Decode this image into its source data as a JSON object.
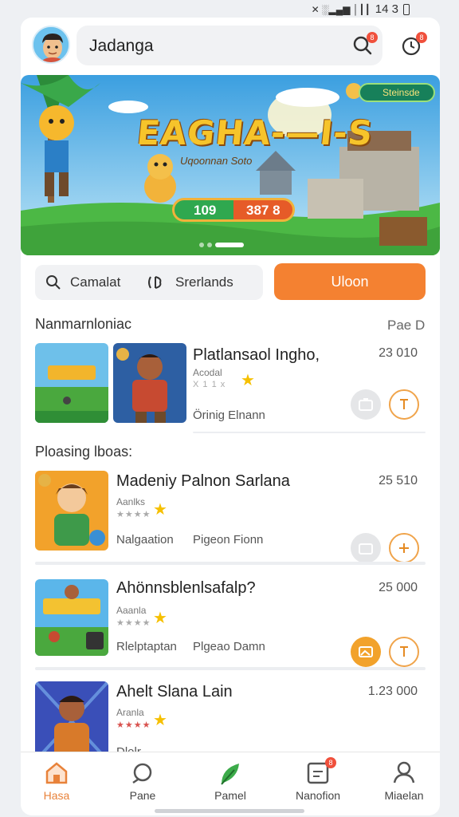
{
  "status_bar": {
    "indicators": "✕ ░▂▄▆ │┃┃",
    "battery": "14 3"
  },
  "header": {
    "search_value": "Jadanga",
    "notif_badge": "8",
    "clock_badge": "8"
  },
  "banner": {
    "title": "EAGHA-—I-S",
    "subtitle": "Uqoonnan Soto",
    "pill_label": "Steinsde",
    "progress_left": "109",
    "progress_right": "387 8"
  },
  "filters": {
    "chip1": "Camalat",
    "chip2": "Srerlands",
    "cta": "Uloon"
  },
  "sections": {
    "s1_title": "Nanmarnloniac",
    "s1_link": "Pae D",
    "s2_title": "Ploasing lboas:"
  },
  "items": [
    {
      "title": "Platlansaol Ingho,",
      "price": "23 010",
      "meta": "Acodal",
      "stars": "★★★★★",
      "rating_text": "X 1 1 x",
      "sub": "Örinig Elnann"
    },
    {
      "title": "Madeniy Palnon Sarlana",
      "price": "25 510",
      "meta": "Aanlks",
      "stars": "★★★★",
      "sub_left": "Nalgaation",
      "sub_right": "Pigeon Fionn"
    },
    {
      "title": "Ahönnsblenlsafalp?",
      "price": "25 000",
      "meta": "Aaanla",
      "stars": "★★★★",
      "sub_left": "Rlelptaptan",
      "sub_right": "Plgeao Damn"
    },
    {
      "title": "Ahelt Slana Lain",
      "price": "1.23 000",
      "meta": "Aranla",
      "stars": "★★★★",
      "sub_left": "Dlelr"
    }
  ],
  "tabs": [
    {
      "label": "Hasa"
    },
    {
      "label": "Pane"
    },
    {
      "label": "Pamel"
    },
    {
      "label": "Nanofion",
      "badge": "8"
    },
    {
      "label": "Miaelan"
    }
  ],
  "colors": {
    "accent": "#f48131",
    "star": "#f6c000",
    "badge": "#f0503c"
  }
}
